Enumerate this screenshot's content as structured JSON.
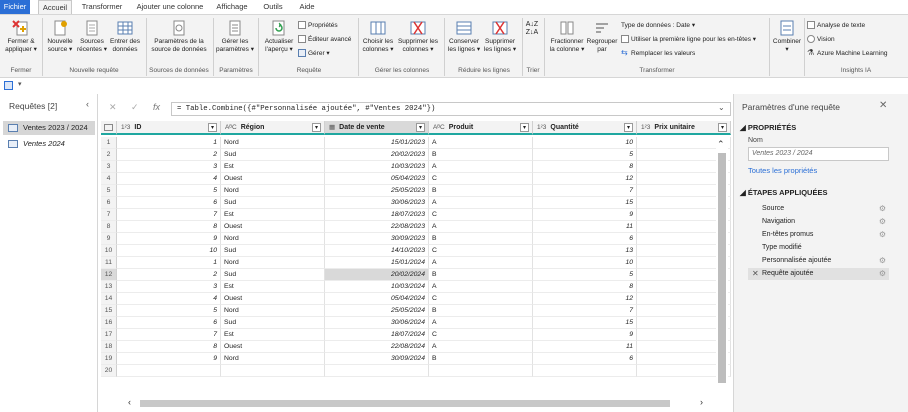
{
  "menu": {
    "tabs": [
      "Fichier",
      "Accueil",
      "Transformer",
      "Ajouter une colonne",
      "Affichage",
      "Outils",
      "Aide"
    ]
  },
  "ribbon": {
    "close_apply": [
      "Fermer &",
      "appliquer"
    ],
    "new_source": [
      "Nouvelle",
      "source"
    ],
    "recent_sources": [
      "Sources",
      "récentes"
    ],
    "enter_data": [
      "Entrer des",
      "données"
    ],
    "data_source_settings": [
      "Paramètres de la",
      "source de données"
    ],
    "manage_params": [
      "Gérer les",
      "paramètres"
    ],
    "refresh_preview": [
      "Actualiser",
      "l'aperçu"
    ],
    "properties": "Propriétés",
    "advanced_editor": "Éditeur avancé",
    "manage": "Gérer",
    "choose_columns": [
      "Choisir les",
      "colonnes"
    ],
    "remove_columns": [
      "Supprimer les",
      "colonnes"
    ],
    "keep_rows": [
      "Conserver",
      "les lignes"
    ],
    "remove_rows": [
      "Supprimer",
      "les lignes"
    ],
    "split_column": [
      "Fractionner",
      "la colonne"
    ],
    "group_by": [
      "Regrouper",
      "par"
    ],
    "data_type": "Type de données : Date",
    "first_row_headers": "Utiliser la première ligne pour les en-têtes",
    "replace_values": "Remplacer les valeurs",
    "combine": "Combiner",
    "text_analysis": "Analyse de texte",
    "vision": "Vision",
    "azure_ml": "Azure Machine Learning",
    "groups": [
      "Fermer",
      "Nouvelle requête",
      "Sources de données",
      "Paramètres",
      "Requête",
      "Gérer les colonnes",
      "Réduire les lignes",
      "Trier",
      "Transformer",
      "Insights IA"
    ]
  },
  "left": {
    "title": "Requêtes [2]",
    "queries": [
      "Ventes 2023 / 2024",
      "Ventes 2024"
    ]
  },
  "formula": "= Table.Combine({#\"Personnalisée ajoutée\", #\"Ventes 2024\"})",
  "columns": [
    {
      "type": "1²3",
      "name": "ID"
    },
    {
      "type": "AᴮC",
      "name": "Région"
    },
    {
      "type": "▦",
      "name": "Date de vente"
    },
    {
      "type": "AᴮC",
      "name": "Produit"
    },
    {
      "type": "1²3",
      "name": "Quantité"
    },
    {
      "type": "1²3",
      "name": "Prix unitaire"
    }
  ],
  "rows": [
    [
      "1",
      "1",
      "Nord",
      "15/01/2023",
      "A",
      "10",
      ""
    ],
    [
      "2",
      "2",
      "Sud",
      "20/02/2023",
      "B",
      "5",
      ""
    ],
    [
      "3",
      "3",
      "Est",
      "10/03/2023",
      "A",
      "8",
      ""
    ],
    [
      "4",
      "4",
      "Ouest",
      "05/04/2023",
      "C",
      "12",
      ""
    ],
    [
      "5",
      "5",
      "Nord",
      "25/05/2023",
      "B",
      "7",
      ""
    ],
    [
      "6",
      "6",
      "Sud",
      "30/06/2023",
      "A",
      "15",
      ""
    ],
    [
      "7",
      "7",
      "Est",
      "18/07/2023",
      "C",
      "9",
      ""
    ],
    [
      "8",
      "8",
      "Ouest",
      "22/08/2023",
      "A",
      "11",
      ""
    ],
    [
      "9",
      "9",
      "Nord",
      "30/09/2023",
      "B",
      "6",
      ""
    ],
    [
      "10",
      "10",
      "Sud",
      "14/10/2023",
      "C",
      "13",
      ""
    ],
    [
      "11",
      "1",
      "Nord",
      "15/01/2024",
      "A",
      "10",
      ""
    ],
    [
      "12",
      "2",
      "Sud",
      "20/02/2024",
      "B",
      "5",
      ""
    ],
    [
      "13",
      "3",
      "Est",
      "10/03/2024",
      "A",
      "8",
      ""
    ],
    [
      "14",
      "4",
      "Ouest",
      "05/04/2024",
      "C",
      "12",
      ""
    ],
    [
      "15",
      "5",
      "Nord",
      "25/05/2024",
      "B",
      "7",
      ""
    ],
    [
      "16",
      "6",
      "Sud",
      "30/06/2024",
      "A",
      "15",
      ""
    ],
    [
      "17",
      "7",
      "Est",
      "18/07/2024",
      "C",
      "9",
      ""
    ],
    [
      "18",
      "8",
      "Ouest",
      "22/08/2024",
      "A",
      "11",
      ""
    ],
    [
      "19",
      "9",
      "Nord",
      "30/09/2024",
      "B",
      "6",
      ""
    ],
    [
      "20",
      "",
      "",
      "",
      "",
      "",
      ""
    ]
  ],
  "right": {
    "title": "Paramètres d'une requête",
    "properties": "PROPRIÉTÉS",
    "name_label": "Nom",
    "name_value": "Ventes 2023 / 2024",
    "all_props": "Toutes les propriétés",
    "steps_title": "ÉTAPES APPLIQUÉES",
    "steps": [
      "Source",
      "Navigation",
      "En-têtes promus",
      "Type modifié",
      "Personnalisée ajoutée",
      "Requête ajoutée"
    ]
  }
}
